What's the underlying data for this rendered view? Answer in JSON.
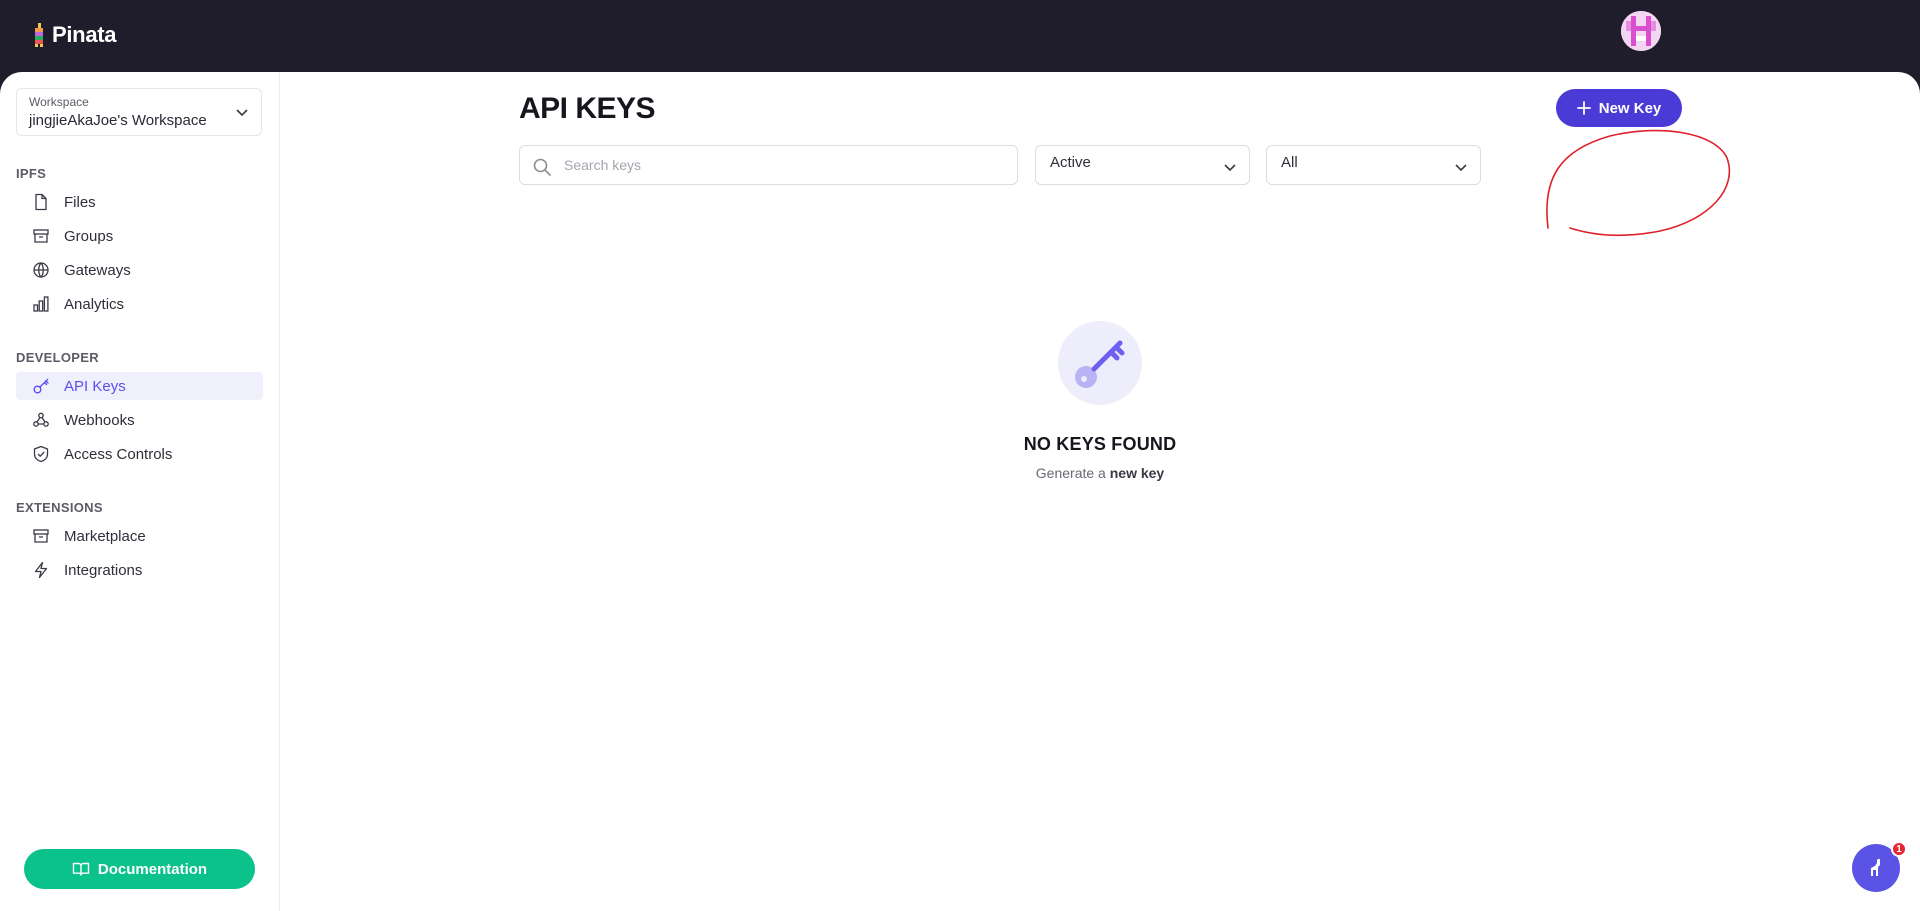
{
  "brand": {
    "name": "Pinata"
  },
  "workspace": {
    "label": "Workspace",
    "name": "jingjieAkaJoe's Workspace"
  },
  "sidebar": {
    "sections": [
      {
        "title": "IPFS",
        "items": [
          {
            "label": "Files",
            "icon": "file-icon"
          },
          {
            "label": "Groups",
            "icon": "archive-icon"
          },
          {
            "label": "Gateways",
            "icon": "globe-icon"
          },
          {
            "label": "Analytics",
            "icon": "bar-chart-icon"
          }
        ]
      },
      {
        "title": "DEVELOPER",
        "items": [
          {
            "label": "API Keys",
            "icon": "key-icon",
            "active": true
          },
          {
            "label": "Webhooks",
            "icon": "webhook-icon"
          },
          {
            "label": "Access Controls",
            "icon": "shield-check-icon"
          }
        ]
      },
      {
        "title": "EXTENSIONS",
        "items": [
          {
            "label": "Marketplace",
            "icon": "archive-icon"
          },
          {
            "label": "Integrations",
            "icon": "bolt-icon"
          }
        ]
      }
    ],
    "documentation_label": "Documentation"
  },
  "main": {
    "title": "API KEYS",
    "new_key_label": "New Key",
    "search": {
      "placeholder": "Search keys",
      "value": ""
    },
    "status_filter": {
      "selected": "Active"
    },
    "scope_filter": {
      "selected": "All"
    },
    "empty": {
      "title": "NO KEYS FOUND",
      "subtitle_prefix": "Generate a",
      "subtitle_link": "new key"
    }
  },
  "chat": {
    "badge_count": "1"
  },
  "colors": {
    "topbar_bg": "#1f1d2b",
    "accent": "#4b3bd6",
    "active_nav": "#5a4ff0",
    "documentation_bg": "#0bc28b",
    "annotation": "#e0202a",
    "badge": "#e5252f"
  }
}
